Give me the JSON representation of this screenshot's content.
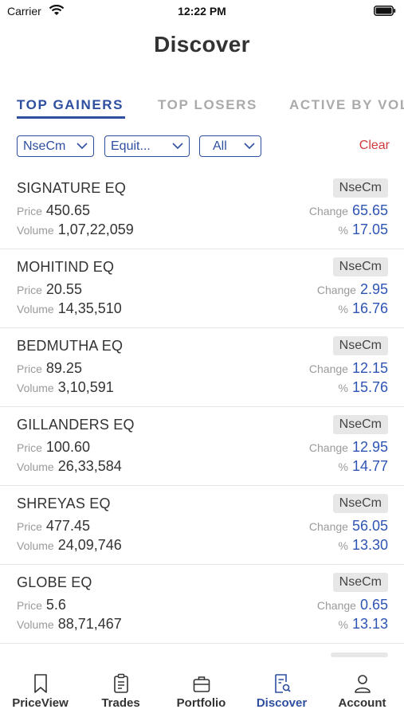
{
  "status_bar": {
    "carrier": "Carrier",
    "time": "12:22 PM"
  },
  "header": {
    "title": "Discover"
  },
  "tabs": [
    {
      "label": "TOP GAINERS",
      "active": true
    },
    {
      "label": "TOP LOSERS",
      "active": false
    },
    {
      "label": "ACTIVE BY VOLUME",
      "active": false
    }
  ],
  "filters": {
    "exchange": "NseCm",
    "segment": "Equit...",
    "group": "All",
    "clear_label": "Clear"
  },
  "labels": {
    "price": "Price",
    "volume": "Volume",
    "change": "Change",
    "percent": "%"
  },
  "stocks": [
    {
      "name": "SIGNATURE EQ",
      "exchange": "NseCm",
      "price": "450.65",
      "volume": "1,07,22,059",
      "change": "65.65",
      "percent": "17.05"
    },
    {
      "name": "MOHITIND EQ",
      "exchange": "NseCm",
      "price": "20.55",
      "volume": "14,35,510",
      "change": "2.95",
      "percent": "16.76"
    },
    {
      "name": "BEDMUTHA EQ",
      "exchange": "NseCm",
      "price": "89.25",
      "volume": "3,10,591",
      "change": "12.15",
      "percent": "15.76"
    },
    {
      "name": "GILLANDERS EQ",
      "exchange": "NseCm",
      "price": "100.60",
      "volume": "26,33,584",
      "change": "12.95",
      "percent": "14.77"
    },
    {
      "name": "SHREYAS EQ",
      "exchange": "NseCm",
      "price": "477.45",
      "volume": "24,09,746",
      "change": "56.05",
      "percent": "13.30"
    },
    {
      "name": "GLOBE EQ",
      "exchange": "NseCm",
      "price": "5.6",
      "volume": "88,71,467",
      "change": "0.65",
      "percent": "13.13"
    }
  ],
  "bottom_nav": [
    {
      "label": "PriceView",
      "icon": "bookmark-icon",
      "active": false
    },
    {
      "label": "Trades",
      "icon": "clipboard-icon",
      "active": false
    },
    {
      "label": "Portfolio",
      "icon": "briefcase-icon",
      "active": false
    },
    {
      "label": "Discover",
      "icon": "document-search-icon",
      "active": true
    },
    {
      "label": "Account",
      "icon": "person-icon",
      "active": false
    }
  ],
  "colors": {
    "accent": "#2e4fa0",
    "value_blue": "#2e54b4",
    "clear_red": "#d13a3a",
    "badge_bg": "#e7e7e7"
  }
}
